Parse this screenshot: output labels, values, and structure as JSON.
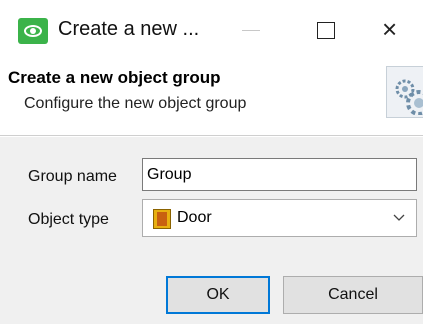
{
  "window": {
    "title": "Create a new ...",
    "controls": {
      "minimize": "—",
      "maximize": "☐",
      "close": "×"
    }
  },
  "header": {
    "title": "Create a new object group",
    "subtitle": "Configure the new object group",
    "icon": "settings-gear-icon"
  },
  "form": {
    "group_name": {
      "label": "Group name",
      "value": "Group"
    },
    "object_type": {
      "label": "Object type",
      "value": "Door",
      "icon": "door-icon"
    }
  },
  "buttons": {
    "ok": "OK",
    "cancel": "Cancel"
  },
  "colors": {
    "app_icon": "#3bb34a",
    "focus_border": "#0078d7",
    "body_bg": "#f0f0f0"
  }
}
